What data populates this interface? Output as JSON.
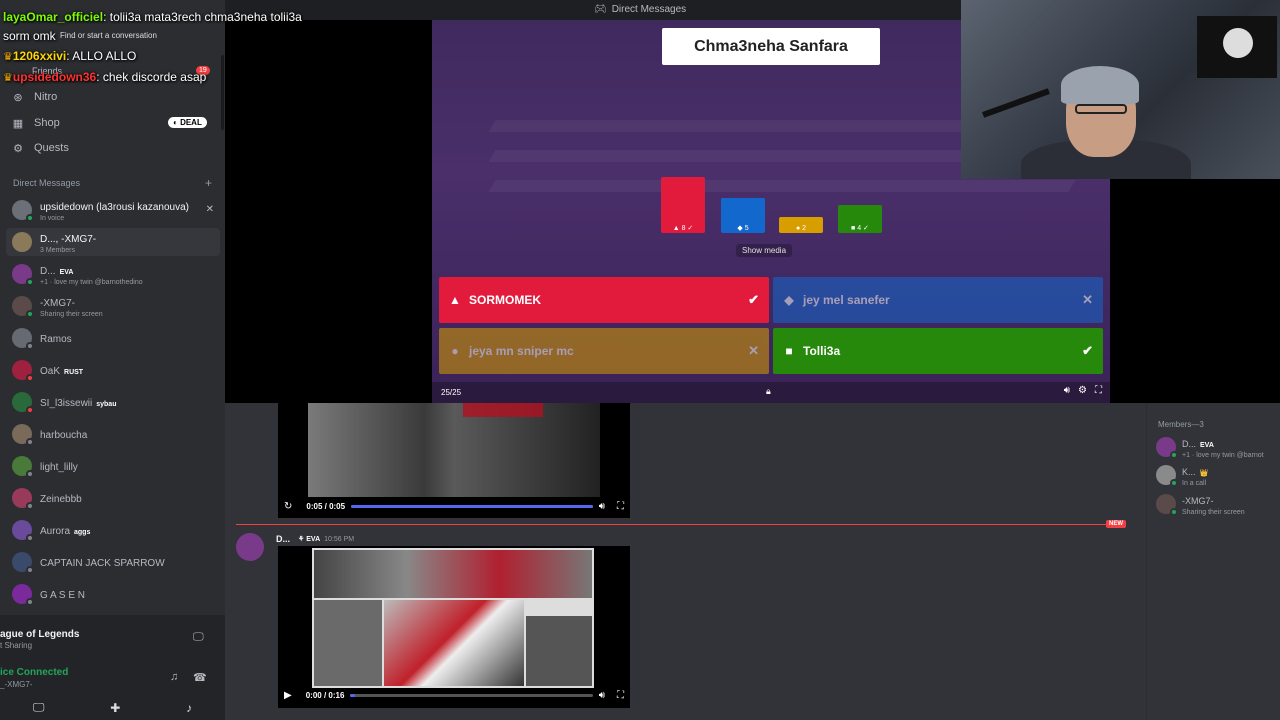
{
  "titlebar": {
    "title": "Direct Messages"
  },
  "overlay_chat": [
    {
      "user": "layaOmar_officiel",
      "message": "tolii3a mata3rech chma3neha tolii3a"
    },
    {
      "user": "",
      "message": "sorm omk"
    },
    {
      "user": "1206xxivi",
      "message": "ALLO ALLO"
    },
    {
      "user": "upsidedown36",
      "message": "chek discorde asap"
    }
  ],
  "sidebar": {
    "search_placeholder": "Find or start a conversation",
    "friends_label": "Friends",
    "friends_badge": "19",
    "nav": [
      {
        "label": "Nitro",
        "icon": "nitro-icon"
      },
      {
        "label": "Shop",
        "icon": "shop-icon",
        "badge": "DEAL"
      },
      {
        "label": "Quests",
        "icon": "quests-icon"
      }
    ],
    "dm_header": "Direct Messages",
    "dms": [
      {
        "name": "upsidedown (la3rousi kazanouva)",
        "sub": "In voice",
        "status": "#23a55a",
        "avatar": "#6b6f78"
      },
      {
        "name": "D..., -XMG7-",
        "sub": "3 Members",
        "status": "",
        "avatar": "#8a7a5a"
      },
      {
        "name": "D...",
        "tag": "EVA",
        "sub": "+1 · love my twin @barnothedino",
        "status": "#23a55a",
        "avatar": "#7a3a8a"
      },
      {
        "name": "-XMG7-",
        "sub": "Sharing their screen",
        "status": "#23a55a",
        "avatar": "#5a4a4a"
      },
      {
        "name": "Ramos",
        "sub": "",
        "status": "#80848e",
        "avatar": "#666a72"
      },
      {
        "name": "OaK",
        "tag": "RUST",
        "sub": "",
        "status": "#f23f43",
        "avatar": "#a02040"
      },
      {
        "name": "SI_l3issewii",
        "tag": "sybau",
        "sub": "",
        "status": "#f23f43",
        "avatar": "#2a6a3a"
      },
      {
        "name": "harboucha",
        "sub": "",
        "status": "#80848e",
        "avatar": "#7a6a5a"
      },
      {
        "name": "light_lilly",
        "sub": "",
        "status": "#80848e",
        "avatar": "#4a7a3a"
      },
      {
        "name": "Zeinebbb",
        "sub": "",
        "status": "#80848e",
        "avatar": "#9a3a5a"
      },
      {
        "name": "Aurora",
        "tag": "aggs",
        "sub": "",
        "status": "#80848e",
        "avatar": "#6a4a9a"
      },
      {
        "name": "CAPTAIN JACK SPARROW",
        "sub": "",
        "status": "#80848e",
        "avatar": "#3a4a6a"
      },
      {
        "name": "G A S E N",
        "sub": "",
        "status": "#80848e",
        "avatar": "#7a2a9a"
      }
    ],
    "activity": {
      "game": "ague of Legends",
      "sub": "t Sharing"
    },
    "voice": {
      "status": "ice Connected",
      "channel": "_-XMG7-"
    }
  },
  "kahoot": {
    "question": "Chma3neha Sanfara",
    "bars": [
      {
        "shape": "▲",
        "count": "8",
        "color": "#e21b3c",
        "correct": true
      },
      {
        "shape": "◆",
        "count": "5",
        "color": "#1368ce",
        "correct": false
      },
      {
        "shape": "●",
        "count": "2",
        "color": "#d89e00",
        "correct": false
      },
      {
        "shape": "■",
        "count": "4",
        "color": "#26890c",
        "correct": true
      }
    ],
    "show_media": "Show media",
    "answers": [
      {
        "text": "SORMOMEK",
        "shape": "▲",
        "color": "#e21b3c",
        "mark": "✔",
        "dim": false
      },
      {
        "text": "jey mel sanefer",
        "shape": "◆",
        "color": "#1368ce",
        "mark": "✕",
        "dim": true
      },
      {
        "text": "jeya mn sniper mc",
        "shape": "●",
        "color": "#d89e00",
        "mark": "✕",
        "dim": true
      },
      {
        "text": "Tolli3a",
        "shape": "■",
        "color": "#26890c",
        "mark": "✔",
        "dim": false
      }
    ],
    "counter": "25/25"
  },
  "members": {
    "header": "Members—3",
    "list": [
      {
        "name": "D...",
        "tag": "EVA",
        "sub": "+1 · love my twin @barnot",
        "status": "#23a55a",
        "avatar": "#7a3a8a"
      },
      {
        "name": "K...",
        "tag": "👑",
        "sub": "In a call",
        "status": "#23a55a",
        "avatar": "#8a8a8a"
      },
      {
        "name": "-XMG7-",
        "sub": "Sharing their screen",
        "status": "#23a55a",
        "avatar": "#5a4a4a"
      }
    ]
  },
  "video1": {
    "time": "0:05 / 0:05",
    "progress": 1.0
  },
  "message": {
    "author": "D...",
    "tag": "EVA",
    "time": "10:56 PM",
    "new_label": "NEW"
  },
  "video2": {
    "time": "0:00 / 0:16",
    "progress": 0.02
  }
}
